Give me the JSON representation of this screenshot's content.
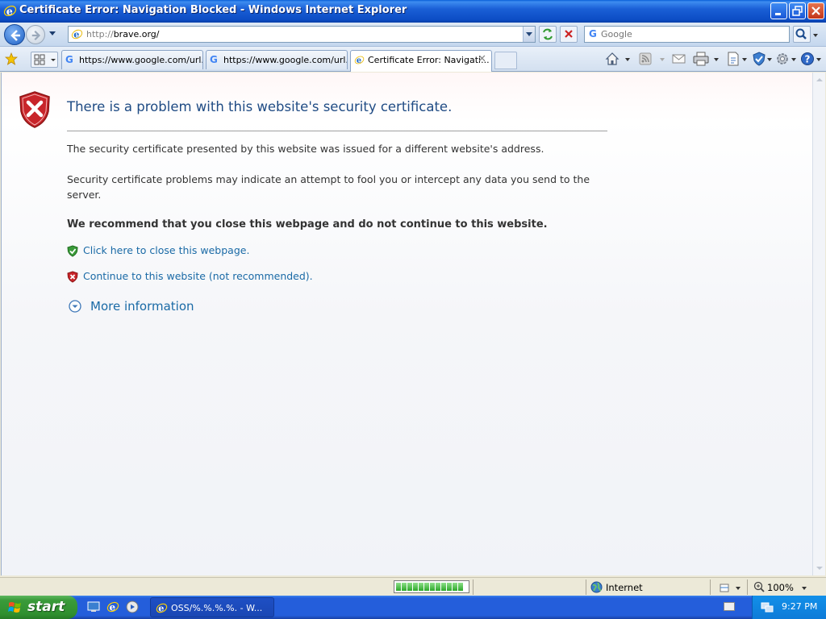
{
  "window": {
    "title": "Certificate Error: Navigation Blocked - Windows Internet Explorer"
  },
  "navbar": {
    "url_protocol": "http://",
    "url_host": "brave.org/",
    "search_placeholder": "Google"
  },
  "tabs": [
    {
      "label": "https://www.google.com/url...",
      "icon": "google-favicon",
      "active": false
    },
    {
      "label": "https://www.google.com/url...",
      "icon": "google-favicon",
      "active": false
    },
    {
      "label": "Certificate Error: Navigati...",
      "icon": "ie-icon",
      "active": true
    }
  ],
  "page": {
    "heading": "There is a problem with this website's security certificate.",
    "para1": "The security certificate presented by this website was issued for a different website's address.",
    "para2": "Security certificate problems may indicate an attempt to fool you or intercept any data you send to the server.",
    "recommendation": "We recommend that you close this webpage and do not continue to this website.",
    "close_link": "Click here to close this webpage.",
    "continue_link": "Continue to this website (not recommended).",
    "more_info": "More information"
  },
  "statusbar": {
    "zone": "Internet",
    "zoom": "100%",
    "progress_fraction": 1.0
  },
  "taskbar": {
    "start_label": "start",
    "task_label": "OSS/%.%.%.%. - W...",
    "clock": "9:27 PM"
  },
  "colors": {
    "link": "#1a6aa6",
    "heading": "#1f4b84",
    "error_red": "#c8252a"
  }
}
